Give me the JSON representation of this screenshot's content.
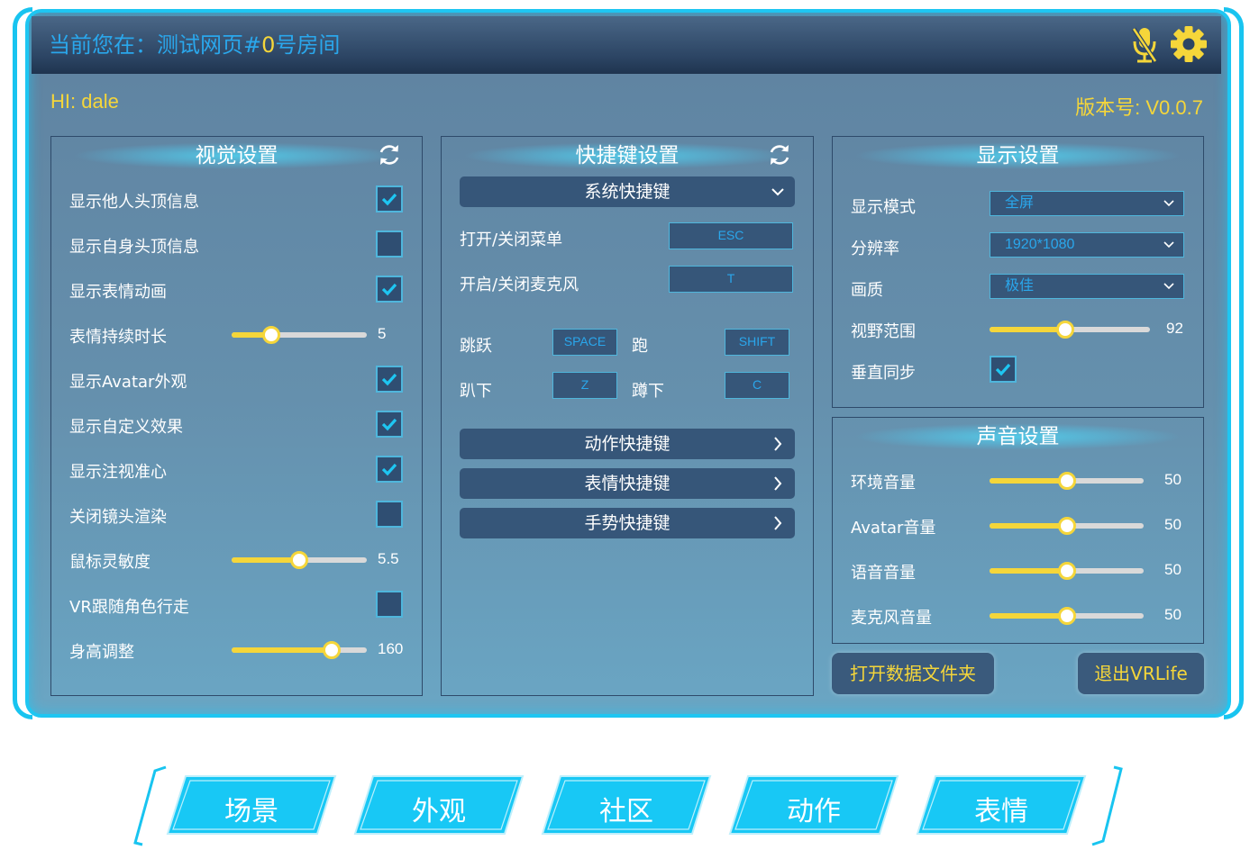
{
  "header": {
    "location_prefix": "当前您在：测试网页#",
    "room_number": "0",
    "location_suffix": "号房间",
    "greeting": "HI: dale",
    "version": "版本号: V0.0.7"
  },
  "visual": {
    "title": "视觉设置",
    "items": [
      {
        "label": "显示他人头顶信息",
        "type": "checkbox",
        "checked": true
      },
      {
        "label": "显示自身头顶信息",
        "type": "checkbox",
        "checked": false
      },
      {
        "label": "显示表情动画",
        "type": "checkbox",
        "checked": true
      },
      {
        "label": "表情持续时长",
        "type": "slider",
        "value": "5",
        "fraction": 0.29
      },
      {
        "label": "显示Avatar外观",
        "type": "checkbox",
        "checked": true
      },
      {
        "label": "显示自定义效果",
        "type": "checkbox",
        "checked": true
      },
      {
        "label": "显示注视准心",
        "type": "checkbox",
        "checked": true
      },
      {
        "label": "关闭镜头渲染",
        "type": "checkbox",
        "checked": false
      },
      {
        "label": "鼠标灵敏度",
        "type": "slider",
        "value": "5.5",
        "fraction": 0.5
      },
      {
        "label": "VR跟随角色行走",
        "type": "checkbox",
        "checked": false
      },
      {
        "label": "身高调整",
        "type": "slider",
        "value": "160",
        "fraction": 0.74
      }
    ]
  },
  "hotkeys": {
    "title": "快捷键设置",
    "system_label": "系统快捷键",
    "menu_label": "打开/关闭菜单",
    "menu_key": "ESC",
    "mic_label": "开启/关闭麦克风",
    "mic_key": "T",
    "jump_label": "跳跃",
    "jump_key": "SPACE",
    "run_label": "跑",
    "run_key": "SHIFT",
    "prone_label": "趴下",
    "prone_key": "Z",
    "crouch_label": "蹲下",
    "crouch_key": "C",
    "action_label": "动作快捷键",
    "emote_label": "表情快捷键",
    "gesture_label": "手势快捷键"
  },
  "display": {
    "title": "显示设置",
    "mode_label": "显示模式",
    "mode_value": "全屏",
    "resolution_label": "分辨率",
    "resolution_value": "1920*1080",
    "quality_label": "画质",
    "quality_value": "极佳",
    "fov_label": "视野范围",
    "fov_value": "92",
    "fov_fraction": 0.47,
    "vsync_label": "垂直同步",
    "vsync_checked": true
  },
  "sound": {
    "title": "声音设置",
    "items": [
      {
        "label": "环境音量",
        "value": "50",
        "fraction": 0.5
      },
      {
        "label": "Avatar音量",
        "value": "50",
        "fraction": 0.5
      },
      {
        "label": "语音音量",
        "value": "50",
        "fraction": 0.5
      },
      {
        "label": "麦克风音量",
        "value": "50",
        "fraction": 0.5
      }
    ]
  },
  "actions": {
    "open_folder": "打开数据文件夹",
    "exit": "退出VRLife"
  },
  "tabs": [
    "场景",
    "外观",
    "社区",
    "动作",
    "表情"
  ],
  "colors": {
    "accent": "#1ec6f2",
    "highlight": "#f5d63a",
    "tab_fill": "#18c8f5"
  }
}
